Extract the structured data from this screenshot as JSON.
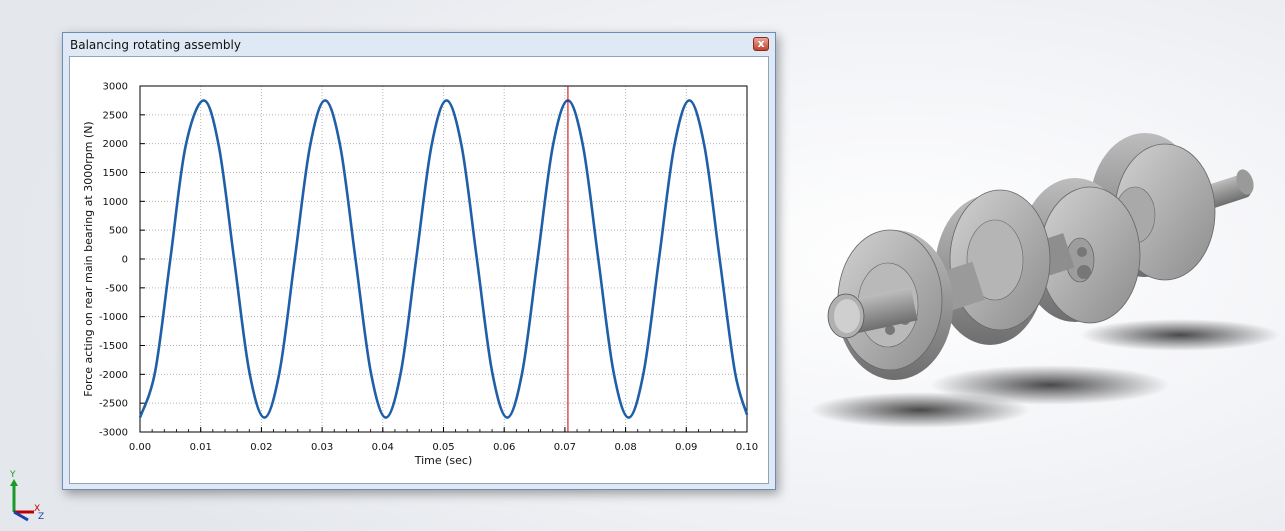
{
  "window": {
    "title": "Balancing rotating assembly",
    "close_glyph": "x"
  },
  "colors": {
    "series": "#1f5fa8",
    "cursor": "#c00000",
    "grid": "#b5b5b5",
    "x_axis_triad": "#c00000",
    "y_axis_triad": "#1a9a2a",
    "z_axis_triad": "#1c3fb0"
  },
  "chart_data": {
    "type": "line",
    "xlabel": "Time (sec)",
    "ylabel": "Force acting on rear main bearing at 3000rpm (N)",
    "xlim": [
      0.0,
      0.1
    ],
    "ylim": [
      -3000,
      3000
    ],
    "xticks": [
      "0.00",
      "0.01",
      "0.02",
      "0.03",
      "0.04",
      "0.05",
      "0.06",
      "0.07",
      "0.08",
      "0.09",
      "0.10"
    ],
    "yticks": [
      "3000",
      "2500",
      "2000",
      "1500",
      "1000",
      "500",
      "0",
      "-500",
      "-1000",
      "-1500",
      "-2000",
      "-2500",
      "-3000"
    ],
    "grid": true,
    "cursor_x": 0.0705,
    "series": [
      {
        "x": [
          0.0,
          0.0025,
          0.005,
          0.0075,
          0.0105,
          0.013,
          0.0155,
          0.018,
          0.0205,
          0.023,
          0.0255,
          0.028,
          0.0305,
          0.033,
          0.0355,
          0.038,
          0.0405,
          0.043,
          0.0455,
          0.048,
          0.0505,
          0.053,
          0.0555,
          0.058,
          0.0605,
          0.063,
          0.0655,
          0.068,
          0.0705,
          0.073,
          0.0755,
          0.078,
          0.0805,
          0.083,
          0.0855,
          0.088,
          0.0905,
          0.093,
          0.0955,
          0.098,
          0.1
        ],
        "y": [
          -2750,
          -1950,
          0,
          1950,
          2750,
          1950,
          0,
          -1950,
          -2750,
          -1950,
          0,
          1950,
          2750,
          1950,
          0,
          -1950,
          -2750,
          -1950,
          0,
          1950,
          2750,
          1950,
          0,
          -1950,
          -2750,
          -1950,
          0,
          1950,
          2750,
          1950,
          0,
          -1950,
          -2750,
          -1950,
          0,
          1950,
          2750,
          1950,
          0,
          -1950,
          -2700
        ]
      }
    ]
  },
  "triad": {
    "y_label": "Y",
    "x_label": "X",
    "z_label": "Z"
  }
}
